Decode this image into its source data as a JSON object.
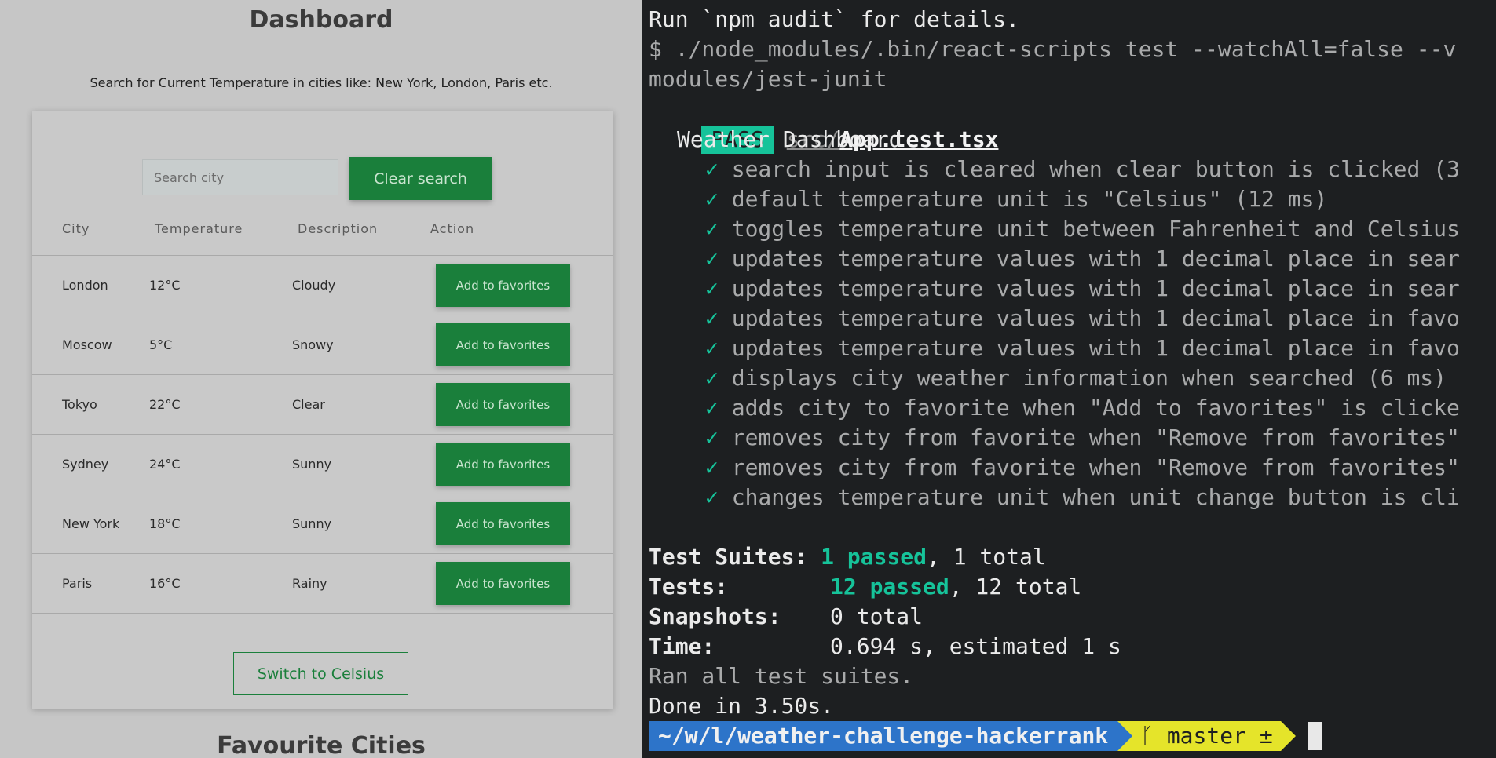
{
  "app": {
    "title": "Dashboard",
    "subtitle": "Search for Current Temperature in cities like: New York, London, Paris etc.",
    "search": {
      "placeholder": "Search city",
      "value": ""
    },
    "clear_label": "Clear search",
    "table": {
      "headers": [
        "City",
        "Temperature",
        "Description",
        "Action"
      ],
      "rows": [
        {
          "city": "London",
          "temperature": "12°C",
          "description": "Cloudy",
          "action": "Add to favorites"
        },
        {
          "city": "Moscow",
          "temperature": "5°C",
          "description": "Snowy",
          "action": "Add to favorites"
        },
        {
          "city": "Tokyo",
          "temperature": "22°C",
          "description": "Clear",
          "action": "Add to favorites"
        },
        {
          "city": "Sydney",
          "temperature": "24°C",
          "description": "Sunny",
          "action": "Add to favorites"
        },
        {
          "city": "New York",
          "temperature": "18°C",
          "description": "Sunny",
          "action": "Add to favorites"
        },
        {
          "city": "Paris",
          "temperature": "16°C",
          "description": "Rainy",
          "action": "Add to favorites"
        }
      ]
    },
    "switch_label": "Switch to Celsius",
    "favourites_heading": "Favourite Cities",
    "colors": {
      "primary_green": "#1a7f3b",
      "background": "#c6c6c6"
    }
  },
  "terminal": {
    "line_audit": "Run `npm audit` for details.",
    "line_cmd": "$ ./node_modules/.bin/react-scripts test --watchAll=false --v",
    "line_cmd_wrap": "modules/jest-junit",
    "pass_badge": "PASS",
    "test_file_dir": "src/",
    "test_file_name": "App.test.tsx",
    "suite_name": "Weather Dashboard",
    "check_mark": "✓",
    "tests": [
      "search input is cleared when clear button is clicked (3",
      "default temperature unit is \"Celsius\" (12 ms)",
      "toggles temperature unit between Fahrenheit and Celsius",
      "updates temperature values with 1 decimal place in sear",
      "updates temperature values with 1 decimal place in sear",
      "updates temperature values with 1 decimal place in favo",
      "updates temperature values with 1 decimal place in favo",
      "displays city weather information when searched (6 ms)",
      "adds city to favorite when \"Add to favorites\" is clicke",
      "removes city from favorite when \"Remove from favorites\"",
      "removes city from favorite when \"Remove from favorites\"",
      "changes temperature unit when unit change button is cli"
    ],
    "summary": {
      "suites_label": "Test Suites:",
      "suites_passed": "1 passed",
      "suites_total": ", 1 total",
      "tests_label": "Tests:",
      "tests_passed": "12 passed",
      "tests_total": ", 12 total",
      "snapshots_label": "Snapshots:",
      "snapshots_value": "0 total",
      "time_label": "Time:",
      "time_value": "0.694 s, estimated 1 s"
    },
    "ran_all": "Ran all test suites.",
    "done": "Done in 3.50s.",
    "prompt": {
      "path": "~/w/l/weather-challenge-hackerrank",
      "branch_icon": "ᚴ",
      "branch": "master ±"
    },
    "colors": {
      "pass": "#16c39a",
      "prompt_path": "#2d74c9",
      "prompt_git": "#e5e42a"
    }
  }
}
